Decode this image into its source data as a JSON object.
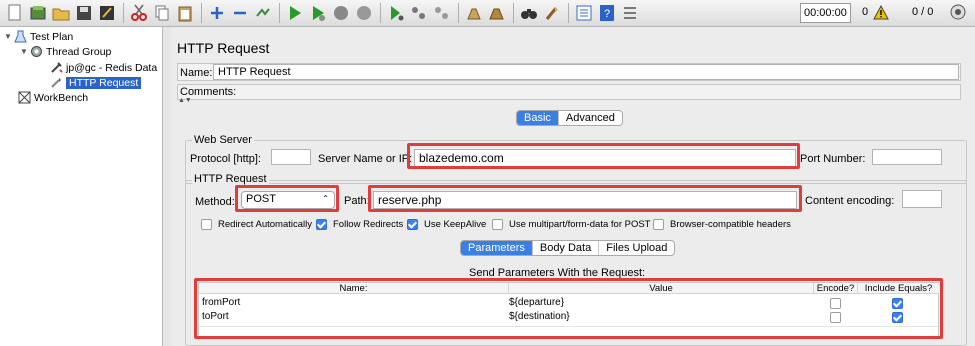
{
  "toolbar": {
    "timer": "00:00:00",
    "warnings": "0",
    "threads": "0 / 0"
  },
  "tree": {
    "items": [
      {
        "label": "Test Plan"
      },
      {
        "label": "Thread Group"
      },
      {
        "label": "jp@gc - Redis Data"
      },
      {
        "label": "HTTP Request"
      },
      {
        "label": "WorkBench"
      }
    ]
  },
  "panel": {
    "title": "HTTP Request",
    "name_label": "Name:",
    "name_value": "HTTP Request",
    "comments_label": "Comments:",
    "tabs": [
      "Basic",
      "Advanced"
    ],
    "web_server": {
      "legend": "Web Server",
      "protocol_label": "Protocol [http]:",
      "protocol_value": "",
      "server_label": "Server Name or IP:",
      "server_value": "blazedemo.com",
      "port_label": "Port Number:",
      "port_value": ""
    },
    "http_request": {
      "legend": "HTTP Request",
      "method_label": "Method:",
      "method_value": "POST",
      "path_label": "Path:",
      "path_value": "reserve.php",
      "encoding_label": "Content encoding:",
      "encoding_value": ""
    },
    "options": [
      {
        "label": "Redirect Automatically",
        "checked": false
      },
      {
        "label": "Follow Redirects",
        "checked": true
      },
      {
        "label": "Use KeepAlive",
        "checked": true
      },
      {
        "label": "Use multipart/form-data for POST",
        "checked": false
      },
      {
        "label": "Browser-compatible headers",
        "checked": false
      }
    ],
    "sub_tabs": [
      "Parameters",
      "Body Data",
      "Files Upload"
    ],
    "params_title": "Send Parameters With the Request:",
    "columns": [
      "Name:",
      "Value",
      "Encode?",
      "Include Equals?"
    ],
    "rows": [
      {
        "name": "fromPort",
        "value": "${departure}",
        "encode": false,
        "include_equals": true
      },
      {
        "name": "toPort",
        "value": "${destination}",
        "encode": false,
        "include_equals": true
      }
    ]
  }
}
